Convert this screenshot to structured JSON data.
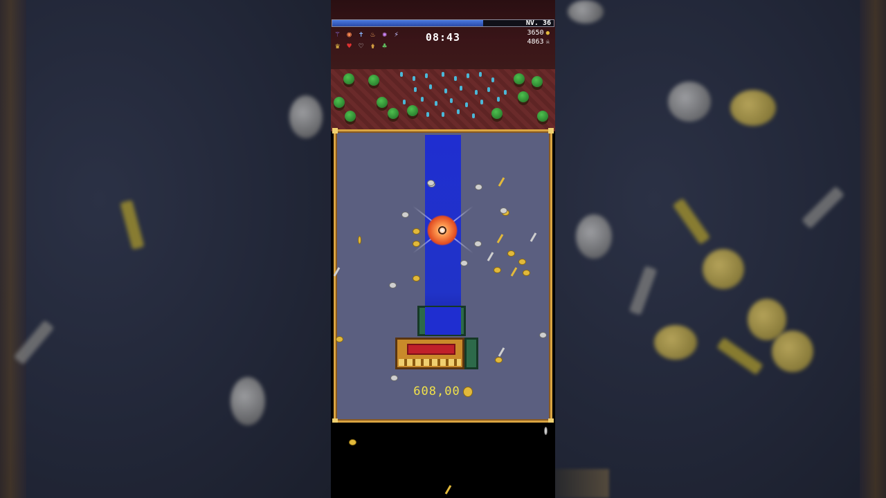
{
  "hud": {
    "level": "NV. 36",
    "xp_fraction": 0.68,
    "timer": "08:43",
    "gold": "3650",
    "kills": "4863",
    "weapons": [
      {
        "icon": "magic-wand-icon",
        "glyph": "⚚"
      },
      {
        "icon": "garlic-icon",
        "glyph": "◉"
      },
      {
        "icon": "bible-icon",
        "glyph": "✝"
      },
      {
        "icon": "fire-wand-icon",
        "glyph": "♨"
      },
      {
        "icon": "rune-icon",
        "glyph": "✺"
      },
      {
        "icon": "lightning-ring-icon",
        "glyph": "⚡"
      }
    ],
    "passives": [
      {
        "icon": "crown-icon",
        "glyph": "♛"
      },
      {
        "icon": "heart-icon",
        "glyph": "♥"
      },
      {
        "icon": "hollow-heart-icon",
        "glyph": "♡"
      },
      {
        "icon": "candelabra-icon",
        "glyph": "⚱"
      },
      {
        "icon": "clover-icon",
        "glyph": "♣"
      }
    ]
  },
  "chest": {
    "gold_counter": "608,00"
  },
  "colors": {
    "panel_bg": "#5b5f80",
    "panel_border": "#d9a441",
    "beam": "#1f2ed0",
    "gold_text": "#f2e24a",
    "xp_fill": "#4a7ae0"
  }
}
